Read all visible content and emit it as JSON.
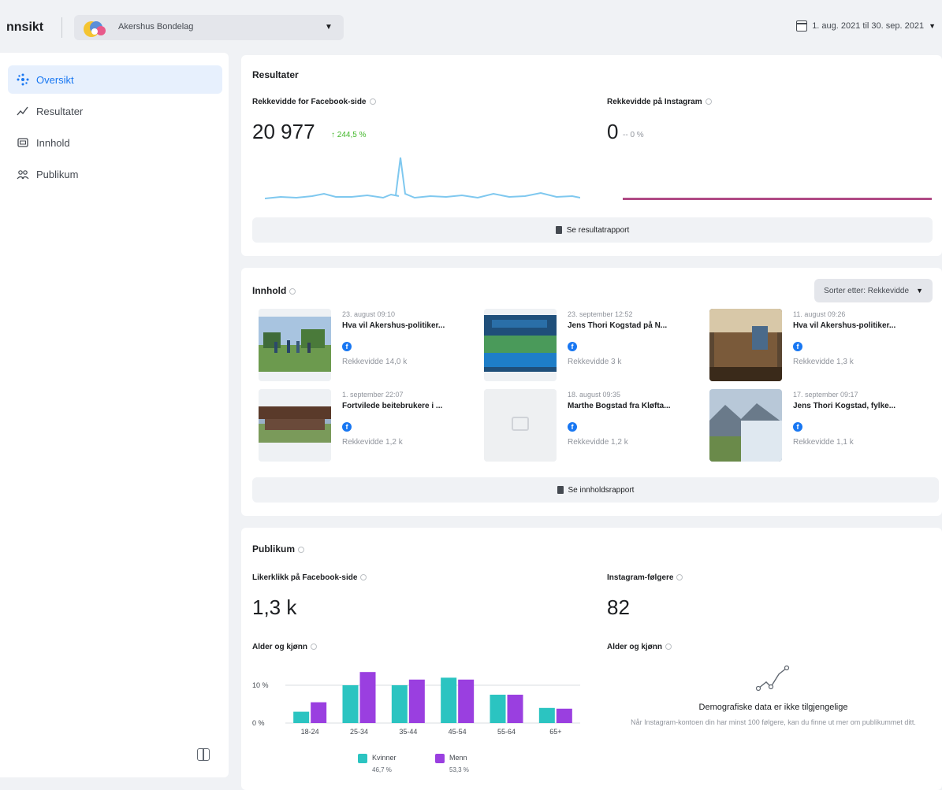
{
  "header": {
    "title": "nnsikt",
    "account_name": "Akershus Bondelag",
    "date_range": "1. aug. 2021 til 30. sep. 2021"
  },
  "sidebar": {
    "items": [
      {
        "label": "Oversikt",
        "icon": "overview-icon",
        "active": true
      },
      {
        "label": "Resultater",
        "icon": "results-icon"
      },
      {
        "label": "Innhold",
        "icon": "content-icon"
      },
      {
        "label": "Publikum",
        "icon": "audience-icon"
      }
    ]
  },
  "results": {
    "title": "Resultater",
    "facebook": {
      "label": "Rekkevidde for Facebook-side",
      "value": "20 977",
      "change": "↑ 244,5 %"
    },
    "instagram": {
      "label": "Rekkevidde på Instagram",
      "value": "0",
      "change": "-- 0 %"
    },
    "report_button": "Se resultatrapport",
    "colors": {
      "facebook_line": "#7fc8ef",
      "instagram_line": "#b04a85"
    }
  },
  "content": {
    "title": "Innhold",
    "sort_label": "Sorter etter: Rekkevidde",
    "posts": [
      {
        "date": "23. august 09:10",
        "title": "Hva vil Akershus-politiker...",
        "reach": "Rekkevidde   14,0 k"
      },
      {
        "date": "23. september 12:52",
        "title": "Jens Thori Kogstad på N...",
        "reach": "Rekkevidde   3 k"
      },
      {
        "date": "11. august 09:26",
        "title": "Hva vil Akershus-politiker...",
        "reach": "Rekkevidde   1,3 k"
      },
      {
        "date": "1. september 22:07",
        "title": "Fortvilede beitebrukere i ...",
        "reach": "Rekkevidde   1,2 k"
      },
      {
        "date": "18. august 09:35",
        "title": "Marthe Bogstad fra Kløfta...",
        "reach": "Rekkevidde   1,2 k"
      },
      {
        "date": "17. september 09:17",
        "title": "Jens Thori Kogstad, fylke...",
        "reach": "Rekkevidde   1,1 k"
      }
    ],
    "report_button": "Se innholdsrapport"
  },
  "audience": {
    "title": "Publikum",
    "facebook_likes_label": "Likerklikk på Facebook-side",
    "facebook_likes_value": "1,3 k",
    "instagram_followers_label": "Instagram-følgere",
    "instagram_followers_value": "82",
    "age_gender_label": "Alder og kjønn",
    "instagram_age_gender_label": "Alder og kjønn",
    "empty_title": "Demografiske data er ikke tilgjengelige",
    "empty_text": "Når Instagram-kontoen din har minst 100 følgere, kan du finne ut mer om publikummet ditt.",
    "legend": [
      {
        "label": "Kvinner",
        "pct": "46,7 %",
        "color": "#2bc4c1"
      },
      {
        "label": "Menn",
        "pct": "53,3 %",
        "color": "#9a3fe0"
      }
    ]
  },
  "chart_data": {
    "type": "bar",
    "categories": [
      "18-24",
      "25-34",
      "35-44",
      "45-54",
      "55-64",
      "65+"
    ],
    "series": [
      {
        "name": "Kvinner",
        "values": [
          3,
          10,
          10,
          12,
          7.5,
          4
        ]
      },
      {
        "name": "Menn",
        "values": [
          5.5,
          13.5,
          11.5,
          11.5,
          7.5,
          3.8
        ]
      }
    ],
    "yticks": [
      "10 %",
      "0 %"
    ],
    "ylim": [
      0,
      15
    ],
    "colors": [
      "#2bc4c1",
      "#9a3fe0"
    ]
  }
}
